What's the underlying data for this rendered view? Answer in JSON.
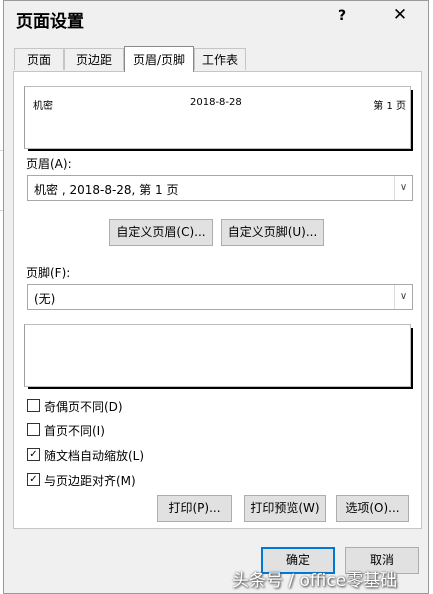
{
  "dialog": {
    "title": "页面设置",
    "help_label": "?",
    "close_label": "✕"
  },
  "tabs": [
    {
      "label": "页面",
      "active": false
    },
    {
      "label": "页边距",
      "active": false
    },
    {
      "label": "页眉/页脚",
      "active": true
    },
    {
      "label": "工作表",
      "active": false
    }
  ],
  "header_preview": {
    "left": "机密",
    "center": "2018-8-28",
    "right": "第 1 页"
  },
  "header_field": {
    "label": "页眉(A):",
    "value": "机密 , 2018-8-28,  第 1 页"
  },
  "custom_buttons": {
    "custom_header": "自定义页眉(C)...",
    "custom_footer": "自定义页脚(U)..."
  },
  "footer_field": {
    "label": "页脚(F):",
    "value": "(无)"
  },
  "options": [
    {
      "label": "奇偶页不同(D)",
      "checked": false
    },
    {
      "label": "首页不同(I)",
      "checked": false
    },
    {
      "label": "随文档自动缩放(L)",
      "checked": true
    },
    {
      "label": "与页边距对齐(M)",
      "checked": true
    }
  ],
  "action_buttons": {
    "print": "打印(P)...",
    "print_preview": "打印预览(W)",
    "options": "选项(O)..."
  },
  "footer_buttons": {
    "ok": "确定",
    "cancel": "取消"
  },
  "watermark": "头条号 / office零基础",
  "colors": {
    "accent": "#0078d7",
    "dialog_bg": "#f0f0f0"
  }
}
